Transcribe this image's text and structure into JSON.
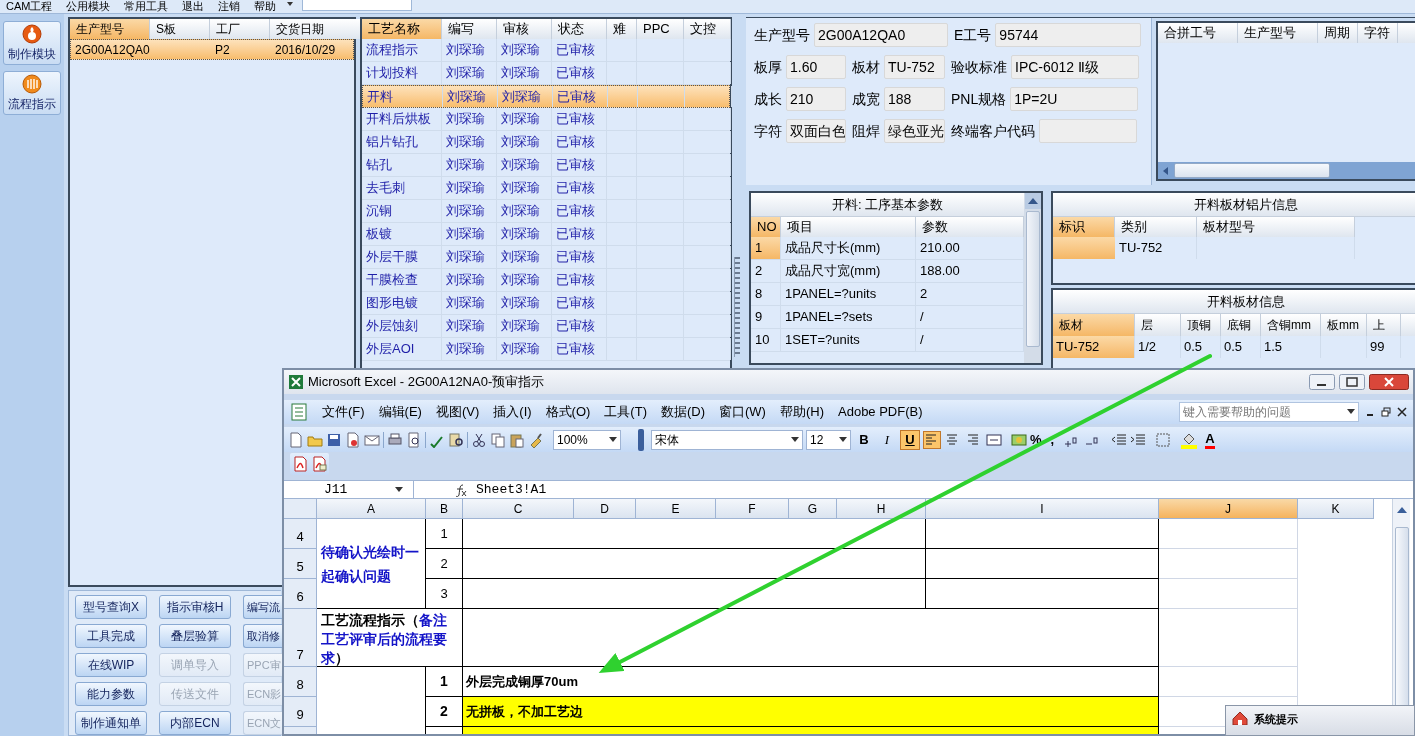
{
  "menu_bar": {
    "items": [
      "CAM工程",
      "公用模块",
      "常用工具",
      "退出",
      "注销",
      "帮助"
    ]
  },
  "sidebar": {
    "items": [
      {
        "label": "制作模块"
      },
      {
        "label": "流程指示"
      }
    ]
  },
  "product_table": {
    "columns": [
      {
        "label": "生产型号",
        "selected": true
      },
      {
        "label": "S板",
        "selected": false
      },
      {
        "label": "工厂",
        "selected": false
      },
      {
        "label": "交货日期",
        "selected": false
      }
    ],
    "rows": [
      {
        "model": "2G00A12QA0",
        "factory": "P2",
        "delivery_date": "2016/10/29",
        "selected": true
      }
    ]
  },
  "action_buttons": [
    {
      "label": "型号查询X",
      "disabled": false
    },
    {
      "label": "指示审核H",
      "disabled": false
    },
    {
      "label": "编写流",
      "disabled": false
    },
    {
      "label": "工具完成",
      "disabled": false
    },
    {
      "label": "叠层验算",
      "disabled": false
    },
    {
      "label": "取消修",
      "disabled": false
    },
    {
      "label": "在线WIP",
      "disabled": false
    },
    {
      "label": "调单导入",
      "disabled": true
    },
    {
      "label": "PPC审",
      "disabled": true
    },
    {
      "label": "能力参数",
      "disabled": false
    },
    {
      "label": "传送文件",
      "disabled": true
    },
    {
      "label": "ECN影",
      "disabled": true
    },
    {
      "label": "制作通知单",
      "disabled": false
    },
    {
      "label": "内部ECN",
      "disabled": false
    },
    {
      "label": "ECN文",
      "disabled": true
    }
  ],
  "process_table": {
    "columns": [
      {
        "label": "工艺名称",
        "selected": true
      },
      {
        "label": "编写",
        "selected": false
      },
      {
        "label": "审核",
        "selected": false
      },
      {
        "label": "状态",
        "selected": false
      },
      {
        "label": "难",
        "selected": false
      },
      {
        "label": "PPC",
        "selected": false
      },
      {
        "label": "文控",
        "selected": false
      }
    ],
    "rows": [
      {
        "name": "流程指示",
        "author": "刘琛瑜",
        "reviewer": "刘琛瑜",
        "status": "已审核",
        "selected": false
      },
      {
        "name": "计划投料",
        "author": "刘琛瑜",
        "reviewer": "刘琛瑜",
        "status": "已审核",
        "selected": false
      },
      {
        "name": "开料",
        "author": "刘琛瑜",
        "reviewer": "刘琛瑜",
        "status": "已审核",
        "selected": true
      },
      {
        "name": "开料后烘板",
        "author": "刘琛瑜",
        "reviewer": "刘琛瑜",
        "status": "已审核",
        "selected": false
      },
      {
        "name": "铝片钻孔",
        "author": "刘琛瑜",
        "reviewer": "刘琛瑜",
        "status": "已审核",
        "selected": false
      },
      {
        "name": "钻孔",
        "author": "刘琛瑜",
        "reviewer": "刘琛瑜",
        "status": "已审核",
        "selected": false
      },
      {
        "name": "去毛刺",
        "author": "刘琛瑜",
        "reviewer": "刘琛瑜",
        "status": "已审核",
        "selected": false
      },
      {
        "name": "沉铜",
        "author": "刘琛瑜",
        "reviewer": "刘琛瑜",
        "status": "已审核",
        "selected": false
      },
      {
        "name": "板镀",
        "author": "刘琛瑜",
        "reviewer": "刘琛瑜",
        "status": "已审核",
        "selected": false
      },
      {
        "name": "外层干膜",
        "author": "刘琛瑜",
        "reviewer": "刘琛瑜",
        "status": "已审核",
        "selected": false
      },
      {
        "name": "干膜检查",
        "author": "刘琛瑜",
        "reviewer": "刘琛瑜",
        "status": "已审核",
        "selected": false
      },
      {
        "name": "图形电镀",
        "author": "刘琛瑜",
        "reviewer": "刘琛瑜",
        "status": "已审核",
        "selected": false
      },
      {
        "name": "外层蚀刻",
        "author": "刘琛瑜",
        "reviewer": "刘琛瑜",
        "status": "已审核",
        "selected": false
      },
      {
        "name": "外层AOI",
        "author": "刘琛瑜",
        "reviewer": "刘琛瑜",
        "status": "已审核",
        "selected": false
      }
    ]
  },
  "job_info": {
    "fields": [
      {
        "label": "生产型号",
        "value": "2G00A12QA0"
      },
      {
        "label": "E工号",
        "value": "95744"
      },
      {
        "label": "板厚",
        "value": "1.60"
      },
      {
        "label": "板材",
        "value": "TU-752"
      },
      {
        "label": "验收标准",
        "value": "IPC-6012 Ⅱ级"
      },
      {
        "label": "成长",
        "value": "210"
      },
      {
        "label": "成宽",
        "value": "188"
      },
      {
        "label": "PNL规格",
        "value": "1P=2U"
      },
      {
        "label": "字符",
        "value": "双面白色"
      },
      {
        "label": "阻焊",
        "value": "绿色亚光"
      },
      {
        "label": "终端客户代码"
      }
    ]
  },
  "merge_table": {
    "columns": [
      "合拼工号",
      "生产型号",
      "周期",
      "字符"
    ]
  },
  "params_panel": {
    "title": "开料: 工序基本参数",
    "columns": [
      {
        "label": "NO",
        "selected": true
      },
      {
        "label": "项目",
        "selected": false
      },
      {
        "label": "参数",
        "selected": false
      }
    ],
    "rows": [
      {
        "no": "1",
        "item": "成品尺寸长(mm)",
        "value": "210.00",
        "selected": true
      },
      {
        "no": "2",
        "item": "成品尺寸宽(mm)",
        "value": "188.00",
        "selected": false
      },
      {
        "no": "8",
        "item": "1PANEL=?units",
        "value": "2",
        "selected": false
      },
      {
        "no": "9",
        "item": "1PANEL=?sets",
        "value": "/",
        "selected": false
      },
      {
        "no": "10",
        "item": "1SET=?units",
        "value": "/",
        "selected": false
      }
    ]
  },
  "foil_panel": {
    "title": "开料板材铝片信息",
    "columns": [
      {
        "label": "标识",
        "selected": true
      },
      {
        "label": "类别",
        "selected": false
      },
      {
        "label": "板材型号",
        "selected": false
      }
    ],
    "rows": [
      {
        "category": "TU-752",
        "selected": true
      }
    ]
  },
  "board_panel": {
    "title": "开料板材信息",
    "columns": [
      {
        "label": "板材",
        "selected": true
      },
      {
        "label": "层",
        "selected": false
      },
      {
        "label": "顶铜",
        "selected": false
      },
      {
        "label": "底铜",
        "selected": false
      },
      {
        "label": "含铜mm",
        "selected": false
      },
      {
        "label": "板mm",
        "selected": false
      },
      {
        "label": "上",
        "selected": false
      }
    ],
    "rows": [
      {
        "material": "TU-752",
        "layer": "1/2",
        "top_cu": "0.5",
        "bottom_cu": "0.5",
        "cu_mm": "1.5",
        "upper": "99",
        "selected": true
      }
    ]
  },
  "excel": {
    "title": "Microsoft Excel - 2G00A12NA0-预审指示",
    "menu": [
      "文件(F)",
      "编辑(E)",
      "视图(V)",
      "插入(I)",
      "格式(O)",
      "工具(T)",
      "数据(D)",
      "窗口(W)",
      "帮助(H)",
      "Adobe PDF(B)"
    ],
    "help_placeholder": "键入需要帮助的问题",
    "zoom": "100%",
    "font": "宋体",
    "font_size": "12",
    "format_buttons": [
      {
        "label": "B",
        "selected": false
      },
      {
        "label": "I",
        "selected": false
      },
      {
        "label": "U",
        "selected": true
      }
    ],
    "alignments": [
      {
        "selected": true
      },
      {
        "selected": false
      },
      {
        "selected": false
      }
    ],
    "percent": "%",
    "comma": ",",
    "font_color": "A",
    "name_box": "J11",
    "formula": "Sheet3!A1",
    "columns": [
      {
        "label": "A",
        "selected": false
      },
      {
        "label": "B",
        "selected": false
      },
      {
        "label": "C",
        "selected": false
      },
      {
        "label": "D",
        "selected": false
      },
      {
        "label": "E",
        "selected": false
      },
      {
        "label": "F",
        "selected": false
      },
      {
        "label": "G",
        "selected": false
      },
      {
        "label": "H",
        "selected": false
      },
      {
        "label": "I",
        "selected": false
      },
      {
        "label": "J",
        "selected": true
      },
      {
        "label": "K",
        "selected": false
      }
    ],
    "row_numbers": [
      "4",
      "5",
      "6",
      "7",
      "8",
      "9"
    ],
    "confirm_heading": "待确认光绘时一起确认问题",
    "confirm_items": [
      "1",
      "2",
      "3"
    ],
    "process_heading": [
      {
        "text": "工艺流程指示（",
        "highlighted": false
      },
      {
        "text": "备注工艺评审后的流程要求",
        "highlighted": true
      },
      {
        "text": "）",
        "highlighted": false
      }
    ],
    "process_items": [
      {
        "number": "1",
        "text": "外层完成铜厚70um",
        "highlighted": false
      },
      {
        "number": "2",
        "text": "无拼板，不加工艺边",
        "highlighted": true
      },
      {
        "highlighted": true
      }
    ]
  },
  "dialog": {
    "title": "系统提示"
  }
}
